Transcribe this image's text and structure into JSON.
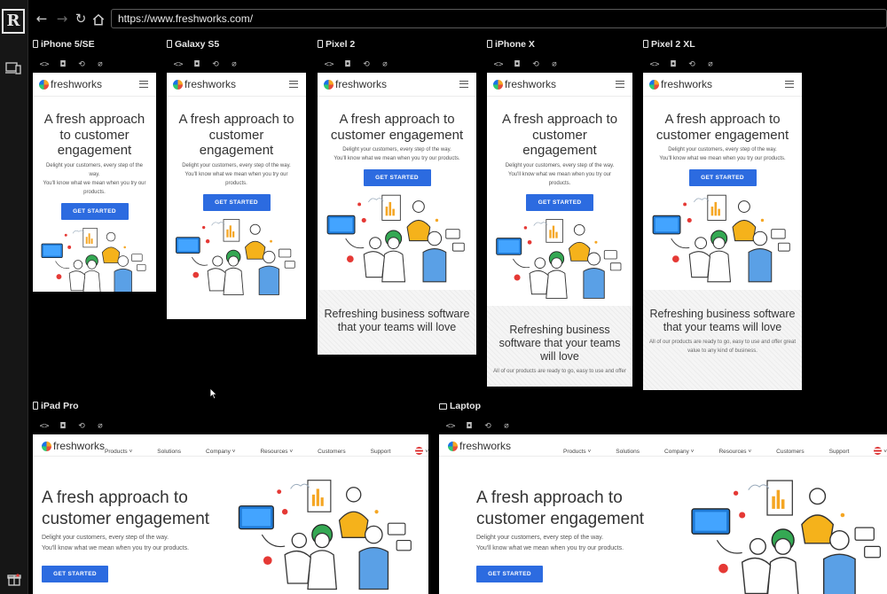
{
  "browser": {
    "url": "https://www.freshworks.com/"
  },
  "icons": {
    "app_logo": "responsively-logo-icon",
    "devices": "devices-icon",
    "gift": "gift-icon",
    "back": "back-arrow-icon",
    "forward": "forward-arrow-icon",
    "reload": "reload-icon",
    "home": "home-icon",
    "tools": [
      "code-icon",
      "screenshot-icon",
      "rotate-icon",
      "no-sync-icon"
    ]
  },
  "colors": {
    "cta": "#2c6be0",
    "page_bg": "#000000"
  },
  "site": {
    "logo_text": "freshworks",
    "hero_title_lines": [
      "A fresh approach to",
      "customer engagement"
    ],
    "hero_sub_1": "Delight your customers, every step of the way.",
    "hero_sub_2": "You'll know what we mean when you try our products.",
    "cta_label": "GET STARTED",
    "band_title_1": "Refreshing business software",
    "band_title_2": "that your teams will love",
    "band_sub_1": "All of our products are ready to go, easy to use and offer great",
    "band_sub_2": "value to any kind of business.",
    "band_sub_cut": "All of our products are ready to go, easy to use and offer",
    "nav": [
      "Products",
      "Solutions",
      "Company",
      "Resources",
      "Customers",
      "Support"
    ]
  },
  "devices": [
    {
      "name": "iPhone 5/SE"
    },
    {
      "name": "Galaxy S5"
    },
    {
      "name": "Pixel 2"
    },
    {
      "name": "iPhone X"
    },
    {
      "name": "Pixel 2 XL"
    },
    {
      "name": "iPad Pro"
    },
    {
      "name": "Laptop"
    }
  ],
  "wrapped": {
    "iphone5": {
      "title": [
        "A fresh approach",
        "to customer",
        "engagement"
      ],
      "sub": [
        "Delight your customers, every step of the",
        "way.",
        "You'll know what we mean when you try our",
        "products."
      ]
    },
    "galaxy": {
      "title": [
        "A fresh approach to",
        "customer",
        "engagement"
      ],
      "sub": [
        "Delight your customers, every step of the way.",
        "You'll know what we mean when you try our",
        "products."
      ]
    },
    "iphonex": {
      "title": [
        "A fresh approach to",
        "customer",
        "engagement"
      ],
      "sub": [
        "Delight your customers, every step of the way.",
        "You'll know what we mean when you try our",
        "products."
      ],
      "band": [
        "Refreshing business",
        "software that your teams",
        "will love"
      ]
    }
  }
}
